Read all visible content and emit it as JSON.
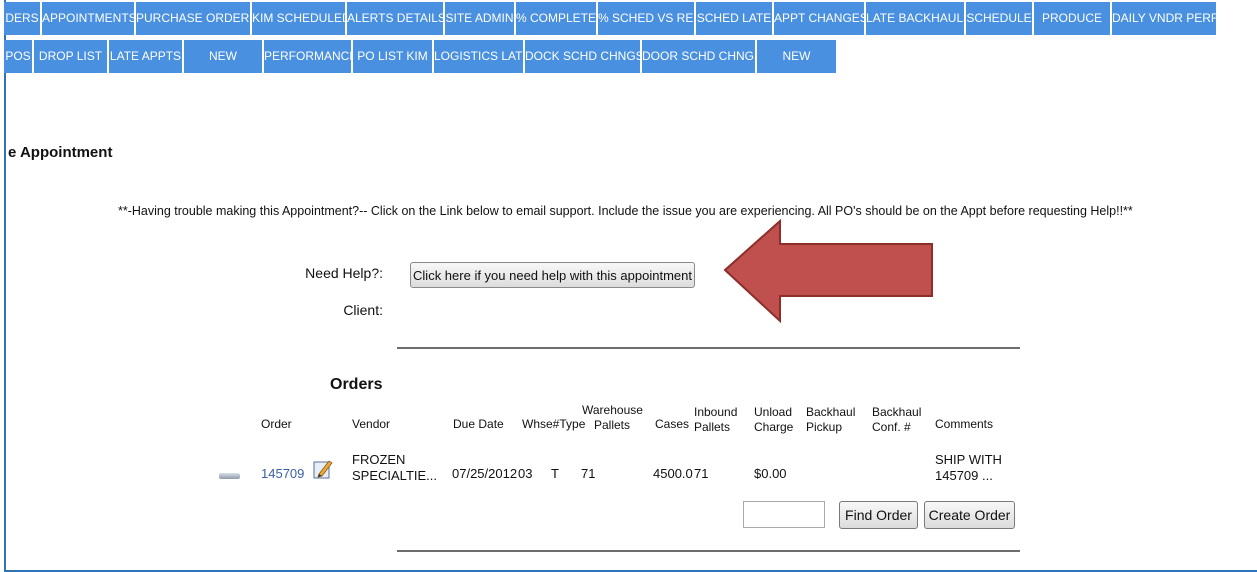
{
  "nav": {
    "row1": [
      "DERS",
      "APPOINTMENTS",
      "PURCHASE ORDERS",
      "KIM SCHEDULED",
      "ALERTS DETAILS",
      "SITE ADMIN",
      "% COMPLETE",
      "% SCHED VS REC",
      "SCHED LATE",
      "APPT CHANGES",
      "LATE BACKHAULS",
      "SCHEDULE",
      "PRODUCE",
      "DAILY VNDR PERF"
    ],
    "row2": [
      "POS",
      "DROP LIST",
      "LATE APPTS",
      "NEW",
      "PERFORMANCE",
      "PO LIST KIM",
      "LOGISTICS LATE",
      "DOCK SCHD CHNGS",
      "DOOR SCHD CHNGS",
      "NEW"
    ]
  },
  "page_title": "e Appointment",
  "notice": "**-Having trouble making this Appointment?-- Click on the Link below to email support. Include the issue you are experiencing. All PO's should be on the Appt before requesting Help!!**",
  "help": {
    "label": "Need Help?:",
    "button": "Click here if you need help with this appointment"
  },
  "client": {
    "label": "Client:"
  },
  "orders": {
    "title": "Orders",
    "headers": {
      "order": "Order",
      "vendor": "Vendor",
      "due_date": "Due Date",
      "whse_type": "Whse#Type",
      "warehouse_pallets_1": "Warehouse",
      "warehouse_pallets_2": "Pallets",
      "cases": "Cases",
      "inbound_pallets_1": "Inbound",
      "inbound_pallets_2": "Pallets",
      "unload_charge_1": "Unload",
      "unload_charge_2": "Charge",
      "backhaul_pickup_1": "Backhaul",
      "backhaul_pickup_2": "Pickup",
      "backhaul_conf_1": "Backhaul",
      "backhaul_conf_2": "Conf. #",
      "comments": "Comments"
    },
    "rows": [
      {
        "order": "145709",
        "vendor_1": "FROZEN",
        "vendor_2": "SPECIALTIE...",
        "due_date": "07/25/2012",
        "whse": "03",
        "type": "T",
        "warehouse_pallets": "71",
        "cases": "4500.0",
        "inbound_pallets": "71",
        "unload_charge": "$0.00",
        "comments_1": "SHIP WITH",
        "comments_2": "145709 ..."
      }
    ],
    "find_order": "Find Order",
    "create_order": "Create Order"
  },
  "colors": {
    "tab": "#4a90e0",
    "arrow": "#c0504d",
    "link": "#3a5fa8"
  }
}
